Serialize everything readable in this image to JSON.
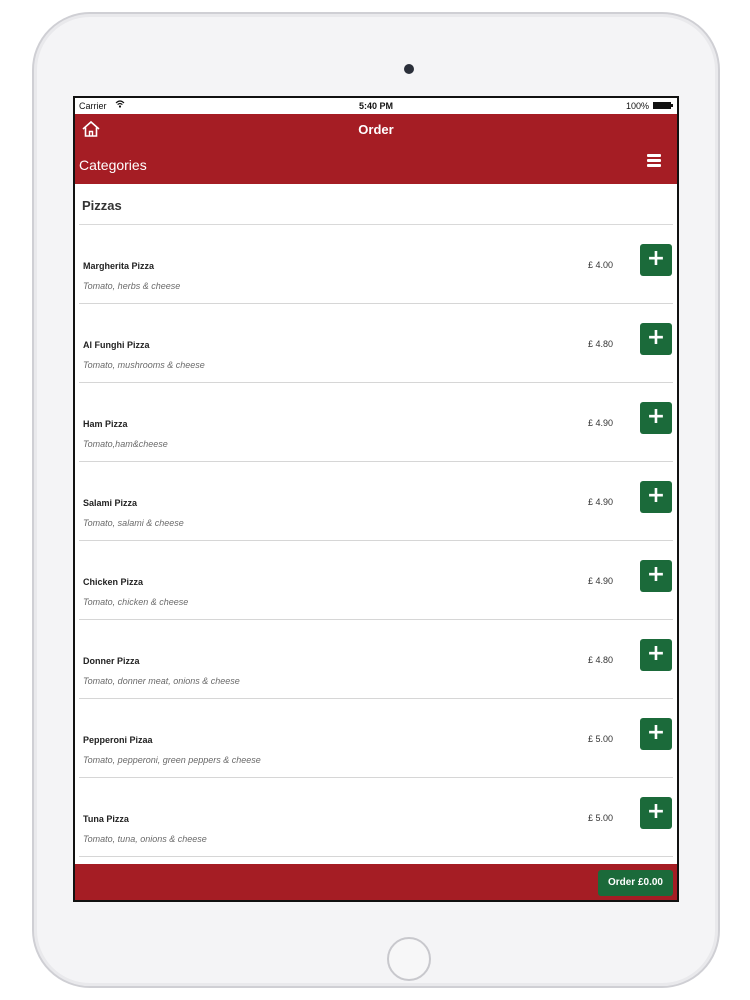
{
  "status_bar": {
    "carrier": "Carrier",
    "time": "5:40 PM",
    "battery": "100%"
  },
  "nav": {
    "title": "Order",
    "left_label": "Categories"
  },
  "section": {
    "title": "Pizzas"
  },
  "items": [
    {
      "name": "Margherita Pizza",
      "desc": "Tomato, herbs & cheese",
      "price": "£ 4.00"
    },
    {
      "name": "Al Funghi Pizza",
      "desc": "Tomato, mushrooms & cheese",
      "price": "£ 4.80"
    },
    {
      "name": "Ham Pizza",
      "desc": "Tomato,ham&cheese",
      "price": "£ 4.90"
    },
    {
      "name": "Salami Pizza",
      "desc": "Tomato, salami & cheese",
      "price": "£ 4.90"
    },
    {
      "name": "Chicken Pizza",
      "desc": "Tomato, chicken & cheese",
      "price": "£ 4.90"
    },
    {
      "name": "Donner Pizza",
      "desc": "Tomato, donner meat, onions & cheese",
      "price": "£ 4.80"
    },
    {
      "name": "Pepperoni Pizaa",
      "desc": "Tomato, pepperoni, green peppers & cheese",
      "price": "£ 5.00"
    },
    {
      "name": "Tuna Pizza",
      "desc": "Tomato, tuna, onions & cheese",
      "price": "£ 5.00"
    }
  ],
  "add_label": "+",
  "footer": {
    "order_button": "Order £0.00"
  },
  "colors": {
    "brand_red": "#a51d24",
    "add_green": "#1b6a3a"
  }
}
